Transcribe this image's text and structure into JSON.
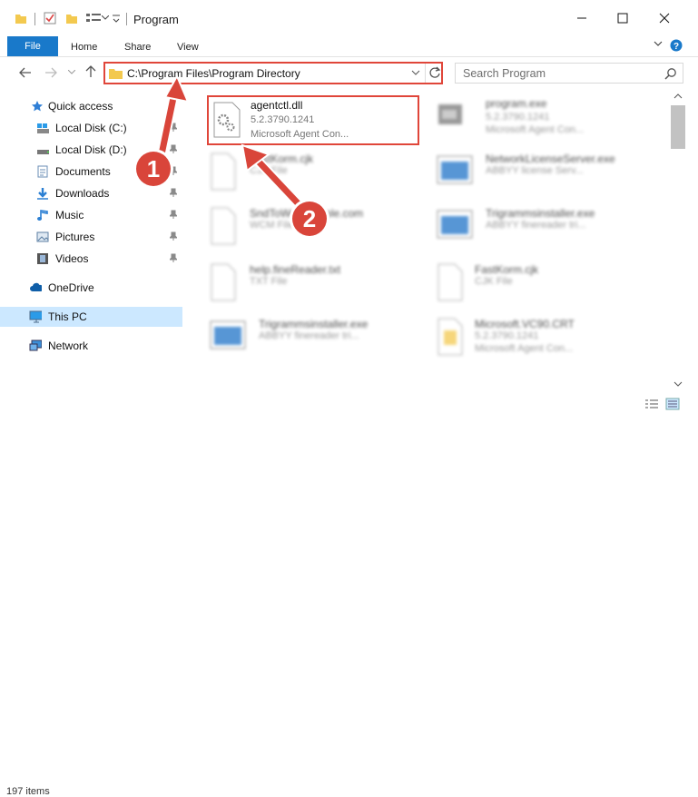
{
  "window": {
    "title": "Program",
    "minimize_icon": "minimize-icon",
    "maximize_icon": "maximize-icon",
    "close_icon": "close-icon"
  },
  "ribbon": {
    "tabs": [
      {
        "label": "File"
      },
      {
        "label": "Home"
      },
      {
        "label": "Share"
      },
      {
        "label": "View"
      }
    ]
  },
  "address": {
    "path": "C:\\Program Files\\Program Directory",
    "search_placeholder": "Search Program"
  },
  "sidebar": {
    "items": [
      {
        "label": "Quick access",
        "icon": "star-icon",
        "pinned": false
      },
      {
        "label": "Local Disk (C:)",
        "icon": "drive-icon",
        "pinned": true
      },
      {
        "label": "Local Disk (D:)",
        "icon": "drive-icon",
        "pinned": true
      },
      {
        "label": "Documents",
        "icon": "documents-icon",
        "pinned": true
      },
      {
        "label": "Downloads",
        "icon": "download-icon",
        "pinned": true
      },
      {
        "label": "Music",
        "icon": "music-icon",
        "pinned": true
      },
      {
        "label": "Pictures",
        "icon": "pictures-icon",
        "pinned": true
      },
      {
        "label": "Videos",
        "icon": "videos-icon",
        "pinned": true
      },
      {
        "label": "OneDrive",
        "icon": "cloud-icon",
        "pinned": false
      },
      {
        "label": "This PC",
        "icon": "computer-icon",
        "pinned": false
      },
      {
        "label": "Network",
        "icon": "network-icon",
        "pinned": false
      }
    ]
  },
  "files": [
    {
      "name": "agentctl.dll",
      "line2": "5.2.3790.1241",
      "line3": "Microsoft Agent Con...",
      "icon": "gear-file-icon"
    },
    {
      "name": "program.exe",
      "line2": "5.2.3790.1241",
      "line3": "Microsoft Agent Con...",
      "icon": "app-icon"
    },
    {
      "name": "FastKorm.cjk",
      "line2": "CJK File",
      "line3": "",
      "icon": "file-icon"
    },
    {
      "name": "NetworkLicenseServer.exe",
      "line2": "ABBYY license Serv...",
      "line3": "",
      "icon": "window-icon"
    },
    {
      "name": "SndToWordSimple.com",
      "line2": "WCM File",
      "line3": "",
      "icon": "file-icon"
    },
    {
      "name": "Trigrammsinstaller.exe",
      "line2": "ABBYY finereader tri...",
      "line3": "",
      "icon": "window-icon"
    },
    {
      "name": "help.fineReader.txt",
      "line2": "TXT File",
      "line3": "",
      "icon": "file-icon"
    },
    {
      "name": "FastKorm.cjk",
      "line2": "CJK File",
      "line3": "",
      "icon": "file-icon"
    },
    {
      "name": "Trigrammsinstaller.exe",
      "line2": "ABBYY finereader tri...",
      "line3": "",
      "icon": "window-icon"
    },
    {
      "name": "Microsoft.VC90.CRT",
      "line2": "5.2.3790.1241",
      "line3": "Microsoft Agent Con...",
      "icon": "folder-file-icon"
    }
  ],
  "status": {
    "items": "197 items"
  },
  "callouts": [
    "1",
    "2"
  ],
  "colors": {
    "accent": "#1979ca",
    "highlight": "#e0463a",
    "selected": "#cce8ff"
  }
}
